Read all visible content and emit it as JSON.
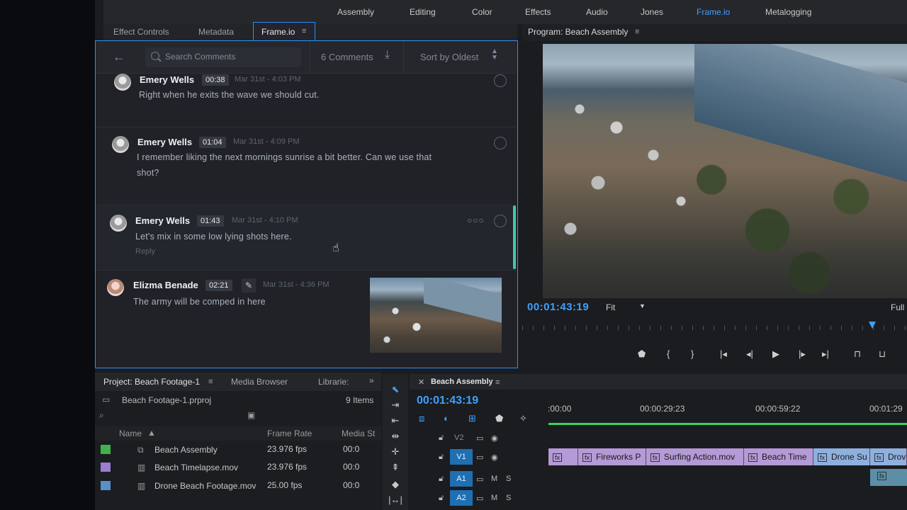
{
  "workspaces": [
    "Assembly",
    "Editing",
    "Color",
    "Effects",
    "Audio",
    "Jones",
    "Frame.io",
    "Metalogging"
  ],
  "frameio": {
    "tabs": [
      "Effect Controls",
      "Metadata",
      "Frame.io"
    ],
    "search_placeholder": "Search Comments",
    "comments_count": "6 Comments",
    "sort_label": "Sort by Oldest",
    "comments": [
      {
        "name": "Emery Wells",
        "time": "00:38",
        "date": "Mar 31st - 4:03 PM",
        "text": "Right when he exits the wave we should cut."
      },
      {
        "name": "Emery Wells",
        "time": "01:04",
        "date": "Mar 31st - 4:09 PM",
        "text_line1": "I remember liking the next mornings sunrise a bit better. Can we use that",
        "text_line2": "shot?"
      },
      {
        "name": "Emery Wells",
        "time": "01:43",
        "date": "Mar 31st - 4:10 PM",
        "text": "Let's mix in some low lying shots here.",
        "reply": "Reply"
      },
      {
        "name": "Elizma Benade",
        "time": "02:21",
        "date": "Mar 31st - 4:36 PM",
        "text": "The army will be comped in here"
      }
    ]
  },
  "program": {
    "title": "Program: Beach Assembly",
    "timecode": "00:01:43:19",
    "fit": "Fit",
    "quality": "Full"
  },
  "project": {
    "tabs": [
      "Project: Beach Footage-1",
      "Media Browser",
      "Librarie:"
    ],
    "file": "Beach Footage-1.prproj",
    "items_count": "9 Items",
    "columns": [
      "Name",
      "Frame Rate",
      "Media St"
    ],
    "rows": [
      {
        "name": "Beach Assembly",
        "rate": "23.976 fps",
        "media": "00:0",
        "color": "#3fb24a"
      },
      {
        "name": "Beach Timelapse.mov",
        "rate": "23.976 fps",
        "media": "00:0",
        "color": "#9a7fd0"
      },
      {
        "name": "Drone Beach Footage.mov",
        "rate": "25.00 fps",
        "media": "00:0",
        "color": "#5b8fc8"
      }
    ]
  },
  "timeline": {
    "title": "Beach Assembly",
    "timecode": "00:01:43:19",
    "ruler": [
      ":00:00",
      "00:00:29:23",
      "00:00:59:22",
      "00:01:29"
    ],
    "tracks": [
      "V2",
      "V1",
      "A1",
      "A2"
    ],
    "clips": [
      "Fireworks P",
      "Surfing Action.mov",
      "Beach Time",
      "Drone Su",
      "Drov"
    ]
  }
}
